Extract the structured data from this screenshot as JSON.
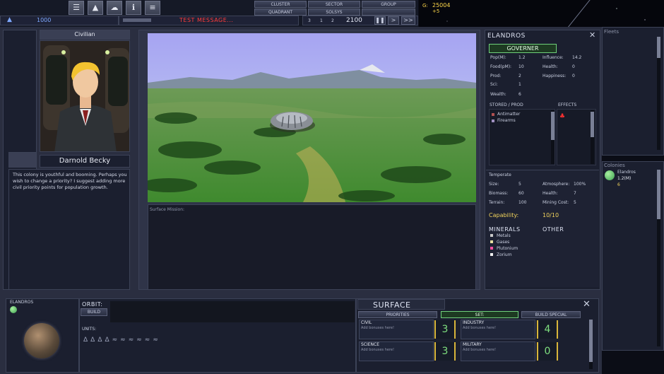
{
  "colors": {
    "accent_red": "#ff3b3b",
    "credits_yellow": "#ffd84a",
    "positive_green": "#6fd07a",
    "number_green": "#7fe07f",
    "number_bracket": "#d8b53a"
  },
  "topbar": {
    "icons": [
      "menu-icon",
      "ship-icon",
      "cloud-icon",
      "info-icon",
      "list-icon"
    ],
    "cluster_btn": "CLUSTER",
    "sector_btn": "SECTOR",
    "group_btn": "GROUP",
    "quadrant_btn": "QUADRANT",
    "sector2_btn": "SOLSYS",
    "message": "TEST MESSAGE...",
    "speed_values": [
      "3",
      "1",
      "2"
    ],
    "date": "2100",
    "credits_label": "G:",
    "credits": "25004",
    "credits_delta": "+5",
    "stat_left": "1000"
  },
  "leader": {
    "role": "Civilian",
    "name": "Darnold Becky",
    "text": "This colony is youthful and booming. Perhaps you wish to change a priority? I suggest adding more civil priority points for population growth."
  },
  "surface_view": {
    "mission_label": "Surface Mission:"
  },
  "planet": {
    "name": "ELANDROS",
    "governor_btn": "GOVERNER",
    "stats": [
      {
        "label": "Pop(M):",
        "value": "1.2"
      },
      {
        "label": "Food(pM):",
        "value": "10"
      },
      {
        "label": "Prod:",
        "value": "2"
      },
      {
        "label": "Sci:",
        "value": "1"
      },
      {
        "label": "Wealth:",
        "value": "6"
      }
    ],
    "stats_right": [
      {
        "label": "Influence:",
        "value": "14.2"
      },
      {
        "label": "Health:",
        "value": "0"
      },
      {
        "label": "Happiness:",
        "value": "0"
      }
    ],
    "stored_header": "STORED / PROD",
    "effects_header": "EFFECTS",
    "stored": [
      "Antimatter",
      "Firearms"
    ],
    "climate": "Temperate",
    "env_left": [
      {
        "label": "Size:",
        "value": "5"
      },
      {
        "label": "Biomass:",
        "value": "60"
      },
      {
        "label": "Terrain:",
        "value": "100"
      }
    ],
    "env_right": [
      {
        "label": "Atmosphere:",
        "value": "100%"
      },
      {
        "label": "Health:",
        "value": "7"
      },
      {
        "label": "Mining Cost:",
        "value": "5"
      }
    ],
    "capability_label": "Capability:",
    "capability": "10/10",
    "minerals_header": "MINERALS",
    "other_header": "OTHER",
    "minerals": [
      "Metals",
      "Gases",
      "Plutonium",
      "Zorium"
    ]
  },
  "right_column": {
    "fleets_header": "Fleets",
    "colonies_header": "Colonies",
    "colony_name": "Elandros",
    "colony_pop": "1.2(M)",
    "colony_count": "6"
  },
  "bottom_left": {
    "planet_name": "ELANDROS",
    "orbit_label": "ORBIT:",
    "build_btn": "BUILD",
    "units_label": "UNITS:"
  },
  "surface_panel": {
    "title": "SURFACE",
    "tabs": [
      "PRIORITIES",
      "SET:",
      "BUILD SPECIAL"
    ],
    "priorities": [
      {
        "name": "CIVIL",
        "hint": "Add bonuses here!",
        "value": "3"
      },
      {
        "name": "INDUSTRY",
        "hint": "Add bonuses here!",
        "value": "4"
      },
      {
        "name": "SCIENCE",
        "hint": "Add bonuses here!",
        "value": "3"
      },
      {
        "name": "MILITARY",
        "hint": "Add bonuses here!",
        "value": "0"
      }
    ]
  }
}
